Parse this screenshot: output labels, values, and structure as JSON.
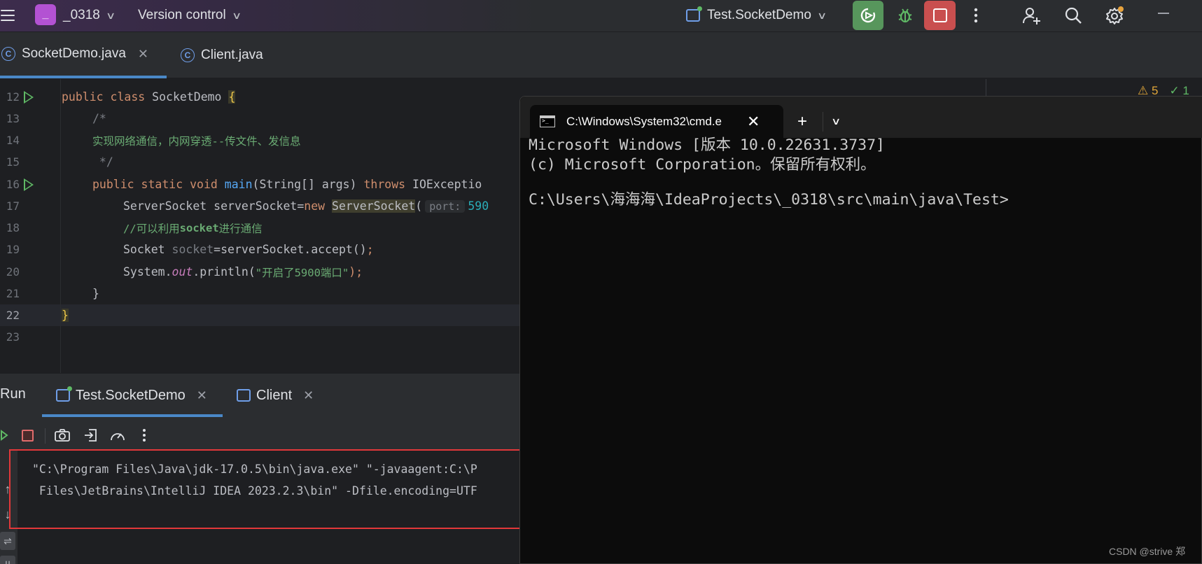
{
  "titlebar": {
    "project_badge": "_",
    "project_name": "_0318",
    "version_control": "Version control",
    "run_config": "Test.SocketDemo"
  },
  "editor_tabs": [
    {
      "label": "SocketDemo.java",
      "icon": "class-icon",
      "active": true
    },
    {
      "label": "Client.java",
      "icon": "class-icon",
      "active": false
    }
  ],
  "editor": {
    "line_numbers": [
      "12",
      "13",
      "14",
      "15",
      "16",
      "17",
      "18",
      "19",
      "20",
      "21",
      "22",
      "23"
    ],
    "lines": {
      "l12": [
        "public",
        " class ",
        "SocketDemo ",
        "{"
      ],
      "l13": "/*",
      "l14": "实现网络通信，内网穿透--传文件、发信息",
      "l15": " */",
      "l16": [
        "public",
        " static",
        " void ",
        "main",
        "(String[] args) ",
        "throws",
        " IOExceptio"
      ],
      "l17": [
        "ServerSocket serverSocket=",
        "new",
        " ",
        "ServerSocket",
        "(",
        "port:",
        "590"
      ],
      "l18": [
        "//可以利用",
        "socket",
        "进行通信"
      ],
      "l19": [
        "Socket ",
        "socket",
        "=serverSocket.accept()",
        ";"
      ],
      "l20": [
        "System.",
        "out",
        ".println(",
        "\"开启了5900端口\"",
        ");"
      ],
      "l21": "}",
      "l22": "}"
    },
    "inspections": {
      "warnings": "5",
      "ok": "1"
    }
  },
  "run_panel": {
    "title": "Run",
    "tabs": [
      {
        "label": "Test.SocketDemo",
        "active": true
      },
      {
        "label": "Client",
        "active": false
      }
    ],
    "console_lines": [
      "\"C:\\Program Files\\Java\\jdk-17.0.5\\bin\\java.exe\" \"-javaagent:C:\\P",
      " Files\\JetBrains\\IntelliJ IDEA 2023.2.3\\bin\" -Dfile.encoding=UTF"
    ]
  },
  "cmd": {
    "tab_title": "C:\\Windows\\System32\\cmd.e",
    "lines": [
      "Microsoft Windows [版本 10.0.22631.3737]",
      "(c) Microsoft Corporation。保留所有权利。",
      "C:\\Users\\海海海\\IdeaProjects\\_0318\\src\\main\\java\\Test>"
    ]
  },
  "watermark": "CSDN @strive 郑",
  "colors": {
    "accent": "#4a88c7",
    "run_green": "#57965c",
    "stop_red": "#c94f4f",
    "highlight_box": "#e2383a"
  }
}
